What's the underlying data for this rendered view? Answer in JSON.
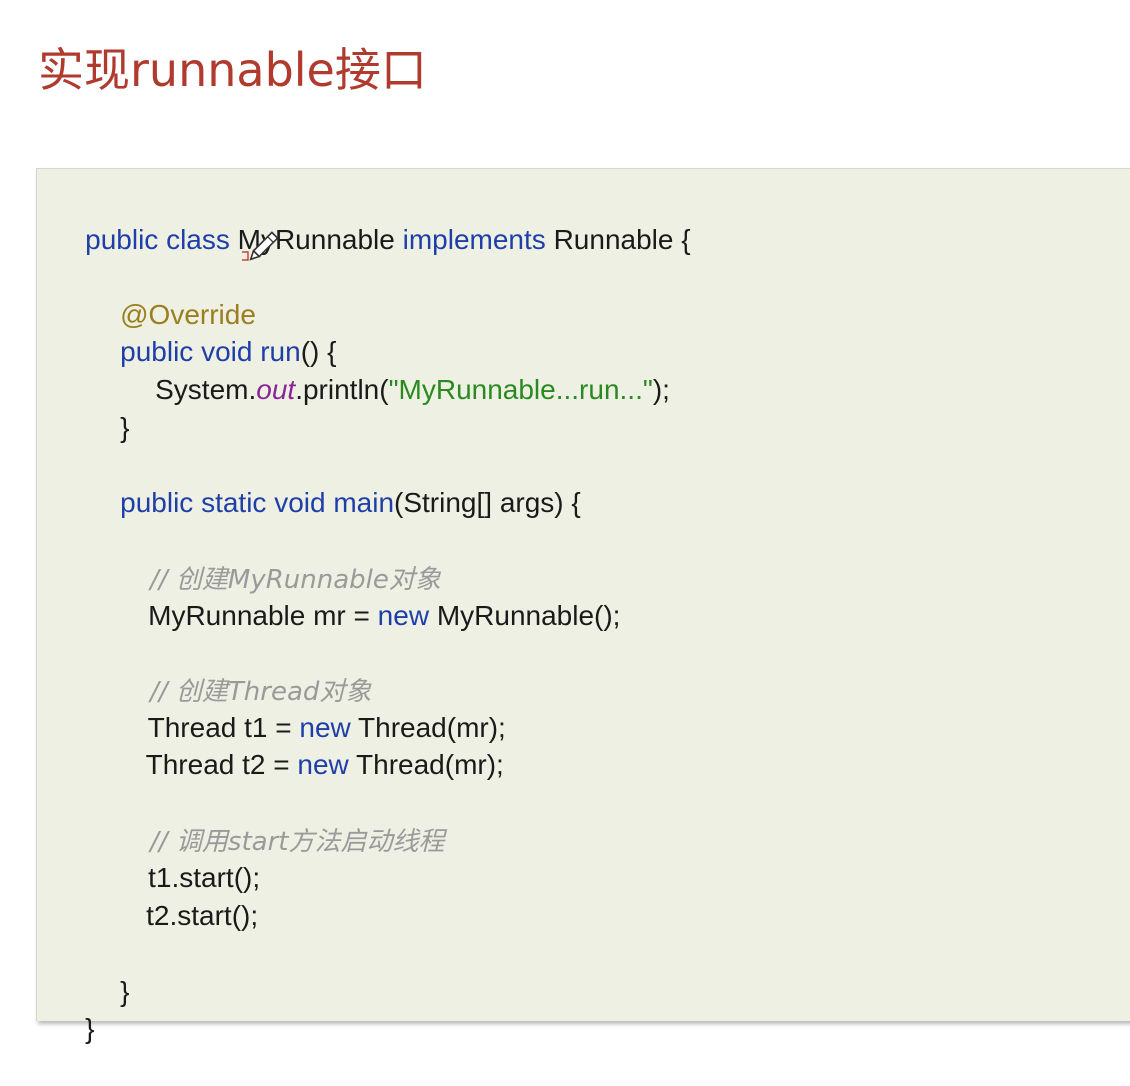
{
  "slide": {
    "title": "实现runnable接口"
  },
  "code": {
    "l1_kw": "public class",
    "l1_name": " MyRunnable ",
    "l1_kw2": "implements",
    "l1_rest": " Runnable {",
    "l2_annotation": "@Override",
    "l3_kw": "public void",
    "l3_method": " run",
    "l3_rest": "() {",
    "l4_a": "System.",
    "l4_field": "out",
    "l4_b": ".println(",
    "l4_str": "\"MyRunnable...run...\"",
    "l4_c": ");",
    "l5_close": "}",
    "l6_kw": "public static void",
    "l6_method": " main",
    "l6_rest": "(String[] args) {",
    "c1": "// 创建MyRunnable对象",
    "l7_a": "MyRunnable mr = ",
    "l7_kw": "new",
    "l7_b": " MyRunnable();",
    "c2": "// 创建Thread对象",
    "l8_a": "Thread t1 = ",
    "l8_kw": "new",
    "l8_b": " Thread(mr);",
    "l9_a": "Thread t2 = ",
    "l9_kw": "new",
    "l9_b": " Thread(mr);",
    "c3": "// 调用start方法启动线程",
    "l10": "t1.start();",
    "l11": "t2.start();",
    "l12_close": "}",
    "l13_close": "}"
  },
  "colors": {
    "title": "#b03a2e",
    "keyword": "#1f3fa8",
    "annotation": "#9b7f1e",
    "static_field": "#8a2596",
    "string": "#2a8a1f",
    "comment": "#9a9a9a",
    "panel_background": "#eef0e4"
  },
  "icons": {
    "pointer": "pencil-cursor-icon"
  }
}
